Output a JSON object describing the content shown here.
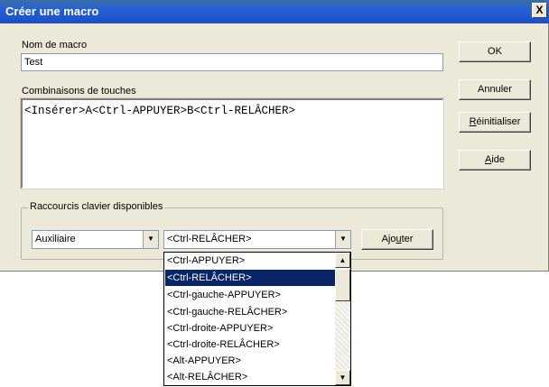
{
  "window": {
    "title": "Créer une macro",
    "close_glyph": "X"
  },
  "macro_name": {
    "label": "Nom de macro",
    "value": "Test"
  },
  "keystrokes": {
    "label": "Combinaisons de touches",
    "value": "<Insérer>A<Ctrl-APPUYER>B<Ctrl-RELÂCHER>"
  },
  "buttons": {
    "ok": "OK",
    "cancel": "Annuler",
    "reset_prefix": "",
    "reset_underline": "R",
    "reset_suffix": "éinitialiser",
    "help_prefix": "",
    "help_underline": "A",
    "help_suffix": "ide",
    "add_prefix": "Ajo",
    "add_underline": "u",
    "add_suffix": "ter"
  },
  "shortcuts_group": {
    "legend": "Raccourcis clavier disponibles",
    "category_value": "Auxiliaire",
    "key_value": "<Ctrl-RELÂCHER>"
  },
  "dropdown_items": [
    "<Ctrl-APPUYER>",
    "<Ctrl-RELÂCHER>",
    "<Ctrl-gauche-APPUYER>",
    "<Ctrl-gauche-RELÂCHER>",
    "<Ctrl-droite-APPUYER>",
    "<Ctrl-droite-RELÂCHER>",
    "<Alt-APPUYER>",
    "<Alt-RELÂCHER>"
  ],
  "dropdown_selected_index": 1,
  "icons": {
    "combo_arrow": "chevron-down-icon",
    "scroll_up": "scroll-up-icon",
    "scroll_down": "scroll-down-icon"
  }
}
